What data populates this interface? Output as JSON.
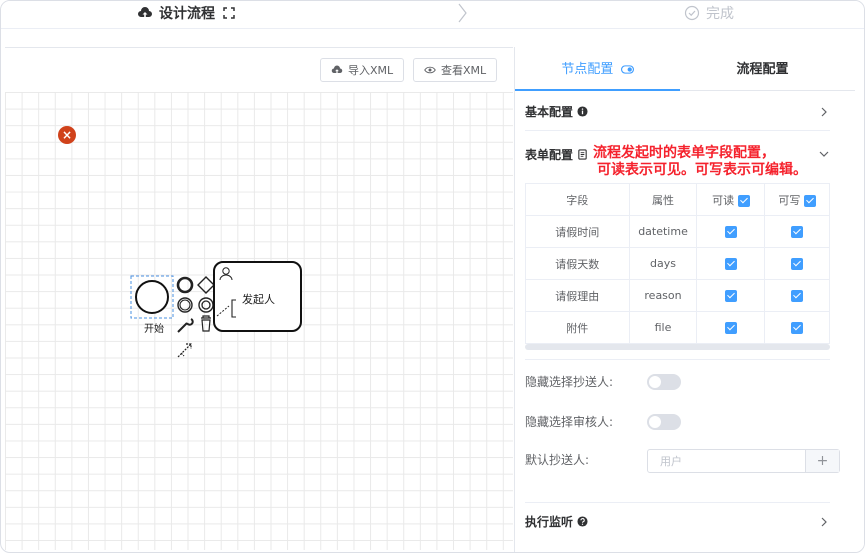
{
  "steps": {
    "design_label": "设计流程",
    "done_label": "完成"
  },
  "toolbar": {
    "import_label": "导入XML",
    "view_label": "查看XML"
  },
  "canvas": {
    "start_label": "开始",
    "initiator_label": "发起人",
    "error_symbol": "×"
  },
  "panel": {
    "tabs": [
      {
        "label": "节点配置"
      },
      {
        "label": "流程配置"
      }
    ],
    "basic_config": "基本配置",
    "form_config": "表单配置",
    "annotation": {
      "line1": "流程发起时的表单字段配置，",
      "line2": "可读表示可见。可写表示可编辑。"
    },
    "table": {
      "headers": [
        "字段",
        "属性",
        "可读",
        "可写"
      ],
      "rows": [
        {
          "field": "请假时间",
          "attr": "datetime",
          "read": true,
          "write": true
        },
        {
          "field": "请假天数",
          "attr": "days",
          "read": true,
          "write": true
        },
        {
          "field": "请假理由",
          "attr": "reason",
          "read": true,
          "write": true
        },
        {
          "field": "附件",
          "attr": "file",
          "read": true,
          "write": true
        }
      ]
    },
    "hide_cc_label": "隐藏选择抄送人:",
    "hide_auditor_label": "隐藏选择审核人:",
    "default_cc_label": "默认抄送人:",
    "default_cc_placeholder": "用户",
    "add_symbol": "+",
    "listener_config": "执行监听"
  },
  "colors": {
    "accent": "#409eff",
    "annotation": "#f5222d",
    "error": "#d0421b"
  }
}
